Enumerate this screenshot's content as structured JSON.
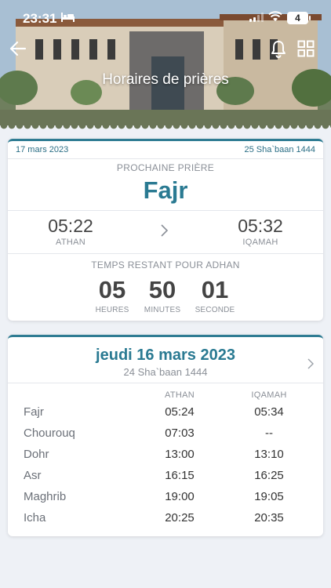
{
  "status": {
    "time": "23:31",
    "battery": "4"
  },
  "header": {
    "title": "Horaires de prières"
  },
  "next_card": {
    "date": "17 mars 2023",
    "hijri": "25 Sha`baan 1444",
    "label": "PROCHAINE PRIÈRE",
    "prayer": "Fajr",
    "athan_time": "05:22",
    "athan_label": "ATHAN",
    "iqamah_time": "05:32",
    "iqamah_label": "IQAMAH",
    "remaining_label": "TEMPS RESTANT POUR ADHAN",
    "hours": "05",
    "hours_label": "HEURES",
    "minutes": "50",
    "minutes_label": "MINUTES",
    "seconds": "01",
    "seconds_label": "SECONDE"
  },
  "day_card": {
    "title": "jeudi 16 mars 2023",
    "hijri": "24 Sha`baan 1444",
    "col_athan": "ATHAN",
    "col_iqamah": "IQAMAH",
    "rows": [
      {
        "name": "Fajr",
        "athan": "05:24",
        "iqamah": "05:34"
      },
      {
        "name": "Chourouq",
        "athan": "07:03",
        "iqamah": "--"
      },
      {
        "name": "Dohr",
        "athan": "13:00",
        "iqamah": "13:10"
      },
      {
        "name": "Asr",
        "athan": "16:15",
        "iqamah": "16:25"
      },
      {
        "name": "Maghrib",
        "athan": "19:00",
        "iqamah": "19:05"
      },
      {
        "name": "Icha",
        "athan": "20:25",
        "iqamah": "20:35"
      }
    ]
  },
  "colors": {
    "accent": "#2a7a92",
    "background": "#eef1f6"
  },
  "icons": [
    "back-arrow-icon",
    "bell-icon",
    "grid-icon",
    "chevron-right-icon",
    "bed-icon",
    "signal-icon",
    "wifi-icon"
  ]
}
